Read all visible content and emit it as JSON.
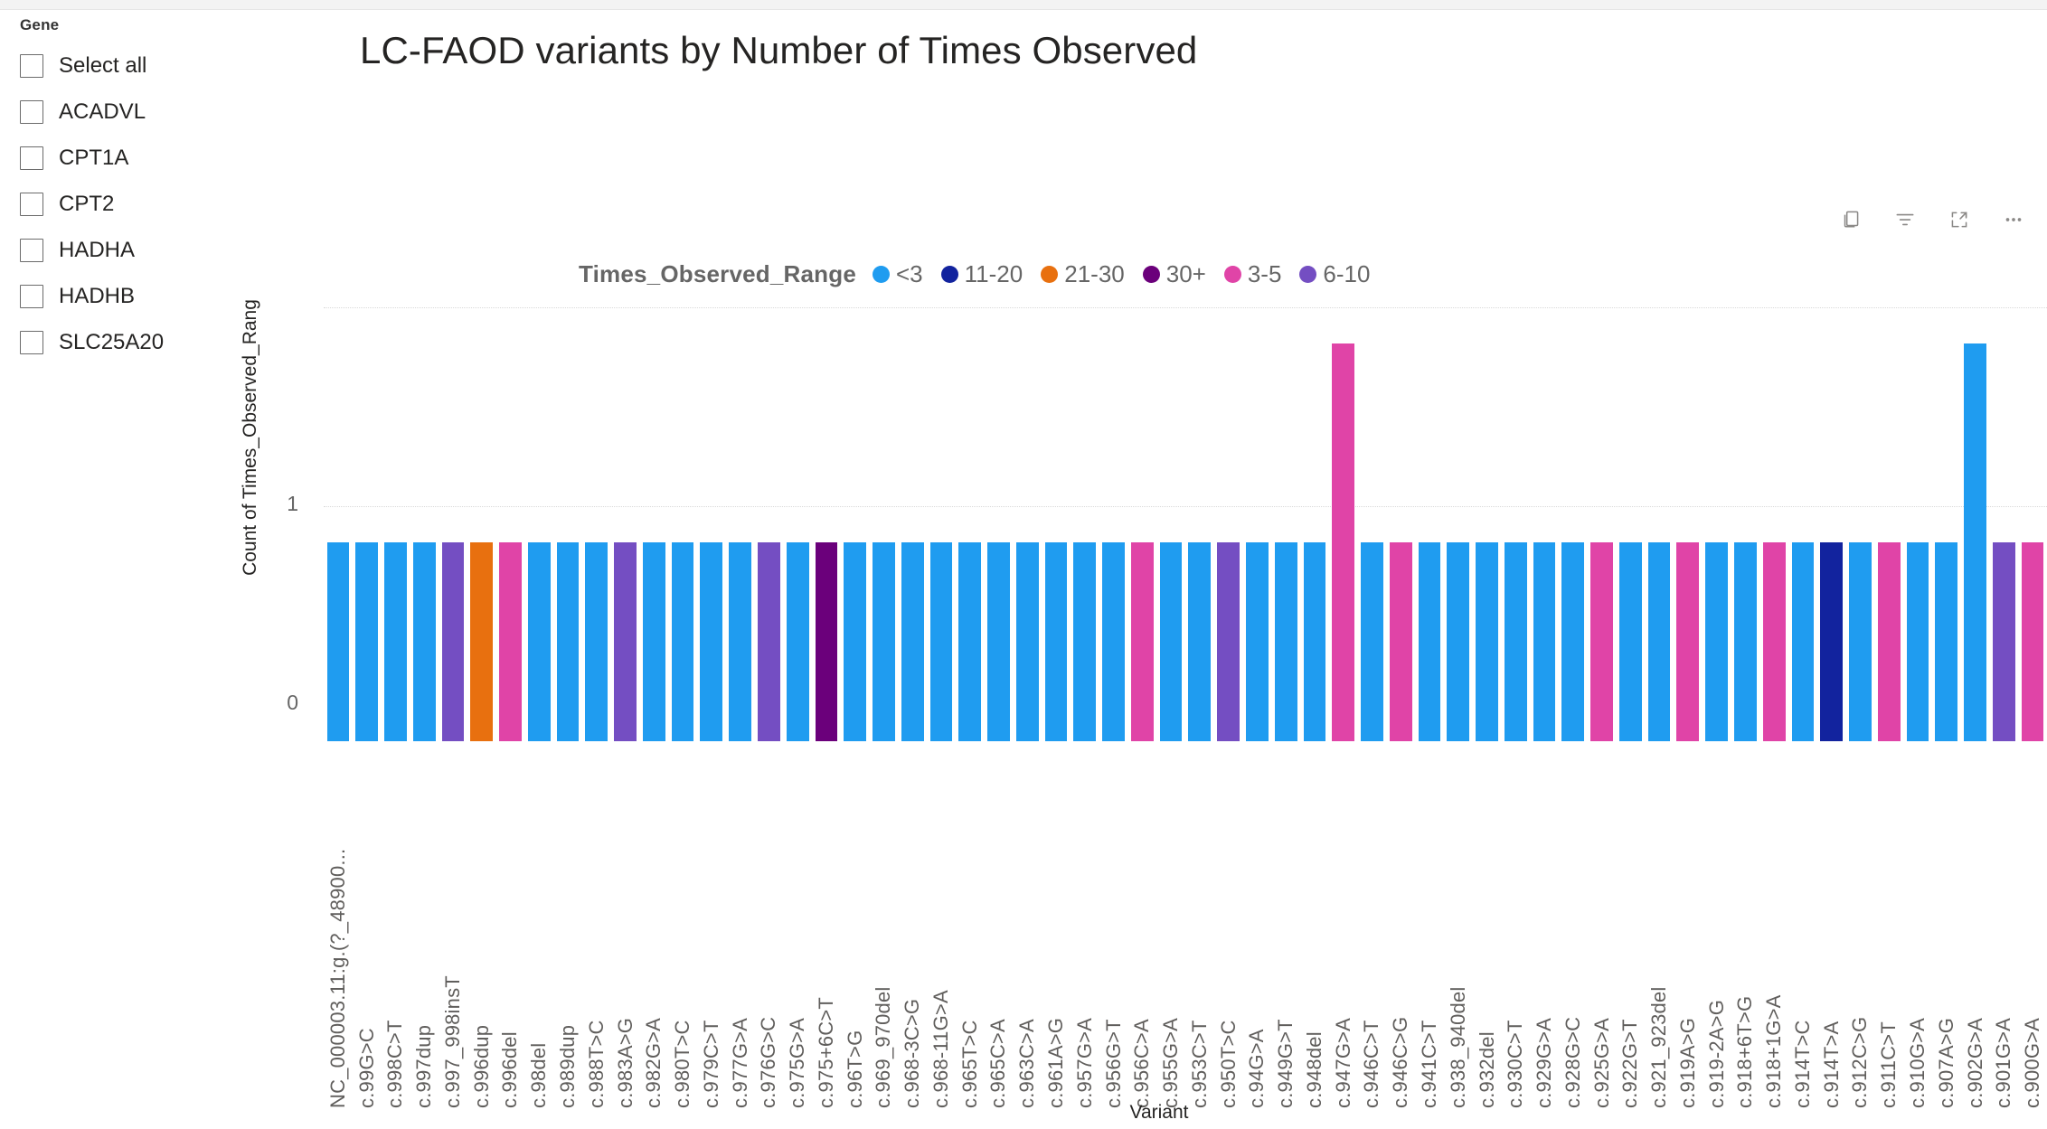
{
  "slicer": {
    "title": "Gene",
    "items": [
      {
        "label": "Select all",
        "checked": false
      },
      {
        "label": "ACADVL",
        "checked": false
      },
      {
        "label": "CPT1A",
        "checked": false
      },
      {
        "label": "CPT2",
        "checked": false
      },
      {
        "label": "HADHA",
        "checked": false
      },
      {
        "label": "HADHB",
        "checked": false
      },
      {
        "label": "SLC25A20",
        "checked": false
      }
    ]
  },
  "toolbar": {
    "icons": [
      "copy-icon",
      "filter-icon",
      "focus-mode-icon",
      "more-options-icon"
    ]
  },
  "legend": {
    "title": "Times_Observed_Range",
    "entries": [
      {
        "label": "<3",
        "color": "#1f9cf0"
      },
      {
        "label": "11-20",
        "color": "#12239e"
      },
      {
        "label": "21-30",
        "color": "#e8700f"
      },
      {
        "label": "30+",
        "color": "#6b007b"
      },
      {
        "label": "3-5",
        "color": "#e044a7"
      },
      {
        "label": "6-10",
        "color": "#744ec2"
      }
    ]
  },
  "chart_data": {
    "type": "bar",
    "title": "LC-FAOD variants by Number of Times Observed",
    "xlabel": "Variant",
    "ylabel": "Count of Times_Observed_Rang",
    "ylim": [
      0,
      2
    ],
    "yticks": [
      "0",
      "1"
    ],
    "grid": true,
    "legend_position": "top",
    "legend_title": "Times_Observed_Range",
    "categories": [
      "NC_000003.11:g.(?_48900...",
      "c.99G>C",
      "c.998C>T",
      "c.997dup",
      "c.997_998insT",
      "c.996dup",
      "c.996del",
      "c.98del",
      "c.989dup",
      "c.988T>C",
      "c.983A>G",
      "c.982G>A",
      "c.980T>C",
      "c.979C>T",
      "c.977G>A",
      "c.976G>C",
      "c.975G>A",
      "c.975+6C>T",
      "c.96T>G",
      "c.969_970del",
      "c.968-3C>G",
      "c.968-11G>A",
      "c.965T>C",
      "c.965C>A",
      "c.963C>A",
      "c.961A>G",
      "c.957G>A",
      "c.956G>T",
      "c.956C>A",
      "c.955G>A",
      "c.953C>T",
      "c.950T>C",
      "c.94G>A",
      "c.949G>T",
      "c.948del",
      "c.947G>A",
      "c.946C>T",
      "c.946C>G",
      "c.941C>T",
      "c.938_940del",
      "c.932del",
      "c.930C>T",
      "c.929G>A",
      "c.928G>C",
      "c.925G>A",
      "c.922G>T",
      "c.921_923del",
      "c.919A>G",
      "c.919-2A>G",
      "c.918+6T>G",
      "c.918+1G>A",
      "c.914T>C",
      "c.914T>A",
      "c.912C>G",
      "c.911C>T",
      "c.910G>A",
      "c.907A>G",
      "c.902G>A",
      "c.901G>A",
      "c.900G>A"
    ],
    "values": [
      1,
      1,
      1,
      1,
      1,
      1,
      1,
      1,
      1,
      1,
      1,
      1,
      1,
      1,
      1,
      1,
      1,
      1,
      1,
      1,
      1,
      1,
      1,
      1,
      1,
      1,
      1,
      1,
      1,
      1,
      1,
      1,
      1,
      1,
      1,
      2,
      1,
      1,
      1,
      1,
      1,
      1,
      1,
      1,
      1,
      1,
      1,
      1,
      1,
      1,
      1,
      1,
      1,
      1,
      1,
      1,
      1,
      2,
      1,
      1
    ],
    "colors": [
      "#1f9cf0",
      "#1f9cf0",
      "#1f9cf0",
      "#1f9cf0",
      "#744ec2",
      "#e8700f",
      "#e044a7",
      "#1f9cf0",
      "#1f9cf0",
      "#1f9cf0",
      "#744ec2",
      "#1f9cf0",
      "#1f9cf0",
      "#1f9cf0",
      "#1f9cf0",
      "#744ec2",
      "#1f9cf0",
      "#6b007b",
      "#1f9cf0",
      "#1f9cf0",
      "#1f9cf0",
      "#1f9cf0",
      "#1f9cf0",
      "#1f9cf0",
      "#1f9cf0",
      "#1f9cf0",
      "#1f9cf0",
      "#1f9cf0",
      "#e044a7",
      "#1f9cf0",
      "#1f9cf0",
      "#744ec2",
      "#1f9cf0",
      "#1f9cf0",
      "#1f9cf0",
      "#e044a7",
      "#1f9cf0",
      "#e044a7",
      "#1f9cf0",
      "#1f9cf0",
      "#1f9cf0",
      "#1f9cf0",
      "#1f9cf0",
      "#1f9cf0",
      "#e044a7",
      "#1f9cf0",
      "#1f9cf0",
      "#e044a7",
      "#1f9cf0",
      "#1f9cf0",
      "#e044a7",
      "#1f9cf0",
      "#12239e",
      "#1f9cf0",
      "#e044a7",
      "#1f9cf0",
      "#1f9cf0",
      "#1f9cf0",
      "#744ec2",
      "#e044a7"
    ],
    "series_by_range": [
      {
        "name": "<3",
        "color": "#1f9cf0",
        "count": 45
      },
      {
        "name": "3-5",
        "color": "#e044a7",
        "count": 9
      },
      {
        "name": "6-10",
        "color": "#744ec2",
        "count": 5
      },
      {
        "name": "11-20",
        "color": "#12239e",
        "count": 1
      },
      {
        "name": "21-30",
        "color": "#e8700f",
        "count": 1
      },
      {
        "name": "30+",
        "color": "#6b007b",
        "count": 1
      }
    ]
  }
}
